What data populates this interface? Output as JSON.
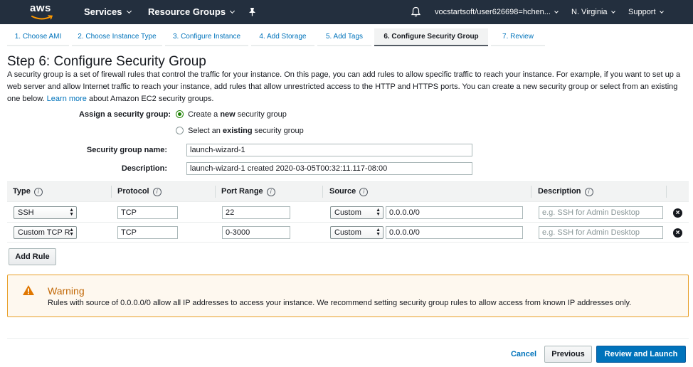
{
  "topnav": {
    "logo": "aws",
    "services": "Services",
    "resource_groups": "Resource Groups",
    "pin_icon": "pin-icon",
    "bell_icon": "bell-icon",
    "account": "vocstartsoft/user626698=hchen...",
    "region": "N. Virginia",
    "support": "Support"
  },
  "tabs": [
    {
      "label": "1. Choose AMI",
      "active": false
    },
    {
      "label": "2. Choose Instance Type",
      "active": false
    },
    {
      "label": "3. Configure Instance",
      "active": false
    },
    {
      "label": "4. Add Storage",
      "active": false
    },
    {
      "label": "5. Add Tags",
      "active": false
    },
    {
      "label": "6. Configure Security Group",
      "active": true
    },
    {
      "label": "7. Review",
      "active": false
    }
  ],
  "page": {
    "title": "Step 6: Configure Security Group",
    "intro_text": "A security group is a set of firewall rules that control the traffic for your instance. On this page, you can add rules to allow specific traffic to reach your instance. For example, if you want to set up a web server and allow Internet traffic to reach your instance, add rules that allow unrestricted access to the HTTP and HTTPS ports. You can create a new security group or select from an existing one below.",
    "learn_more": "Learn more",
    "learn_more_suffix": "about Amazon EC2 security groups."
  },
  "form": {
    "assign_label": "Assign a security group:",
    "option_create_prefix": "Create a",
    "option_create_bold": "new",
    "option_create_suffix": "security group",
    "option_select_prefix": "Select an",
    "option_select_bold": "existing",
    "option_select_suffix": "security group",
    "selected_option": "create",
    "name_label": "Security group name:",
    "name_value": "launch-wizard-1",
    "description_label": "Description:",
    "description_value": "launch-wizard-1 created 2020-03-05T00:32:11.117-08:00"
  },
  "table": {
    "headers": {
      "type": "Type",
      "protocol": "Protocol",
      "port_range": "Port Range",
      "source": "Source",
      "description": "Description"
    },
    "info_glyph": "i",
    "rows": [
      {
        "type": "SSH",
        "protocol": "TCP",
        "port_range": "22",
        "source_mode": "Custom",
        "source_cidr": "0.0.0.0/0",
        "description_placeholder": "e.g. SSH for Admin Desktop"
      },
      {
        "type": "Custom TCP R",
        "protocol": "TCP",
        "port_range": "0-3000",
        "source_mode": "Custom",
        "source_cidr": "0.0.0.0/0",
        "description_placeholder": "e.g. SSH for Admin Desktop"
      }
    ],
    "add_rule": "Add Rule"
  },
  "warning": {
    "title": "Warning",
    "message": "Rules with source of 0.0.0.0/0 allow all IP addresses to access your instance. We recommend setting security group rules to allow access from known IP addresses only.",
    "color": "#e89f28"
  },
  "footer": {
    "cancel": "Cancel",
    "previous": "Previous",
    "review_launch": "Review and Launch"
  },
  "colors": {
    "nav_bg": "#232f3e",
    "link": "#0073bb",
    "primary": "#0073bb",
    "warning_text": "#c16705"
  }
}
